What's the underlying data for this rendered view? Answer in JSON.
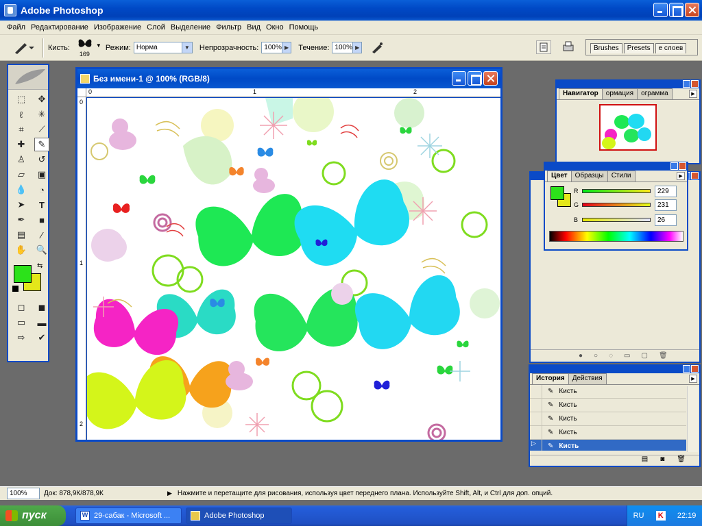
{
  "app": {
    "title": "Adobe Photoshop"
  },
  "menu": [
    "Файл",
    "Редактирование",
    "Изображение",
    "Слой",
    "Выделение",
    "Фильтр",
    "Вид",
    "Окно",
    "Помощь"
  ],
  "options": {
    "brush_label": "Кисть:",
    "brush_size": "169",
    "mode_label": "Режим:",
    "mode_value": "Норма",
    "opacity_label": "Непрозрачность:",
    "opacity_value": "100%",
    "flow_label": "Течение:",
    "flow_value": "100%",
    "palette_tabs": [
      "Brushes",
      "Presets",
      "е слоев"
    ]
  },
  "document": {
    "title": "Без имени-1 @ 100% (RGB/8)",
    "ruler_h": [
      "0",
      "1",
      "2"
    ],
    "ruler_v": [
      "0",
      "1",
      "2"
    ]
  },
  "navigator": {
    "tabs": [
      "Навигатор",
      "ормация",
      "ограмма"
    ]
  },
  "color_panel": {
    "tabs": [
      "Цвет",
      "Образцы",
      "Стили"
    ],
    "R": {
      "label": "R",
      "value": "229"
    },
    "G": {
      "label": "G",
      "value": "231"
    },
    "B": {
      "label": "B",
      "value": "26"
    },
    "fg": "#2ce21a",
    "bg": "#e4e71a"
  },
  "history": {
    "tabs": [
      "История",
      "Действия"
    ],
    "items": [
      "Кисть",
      "Кисть",
      "Кисть",
      "Кисть",
      "Кисть"
    ]
  },
  "status": {
    "zoom": "100%",
    "doc": "Док: 878,9К/878,9К",
    "hint": "Нажмите и перетащите для рисования, используя цвет переднего плана. Используйте Shift, Alt, и Ctrl для доп. опций."
  },
  "taskbar": {
    "start": "пуск",
    "tasks": [
      "29-сабак - Microsoft ...",
      "Adobe Photoshop"
    ],
    "lang": "RU",
    "time": "22:19"
  }
}
